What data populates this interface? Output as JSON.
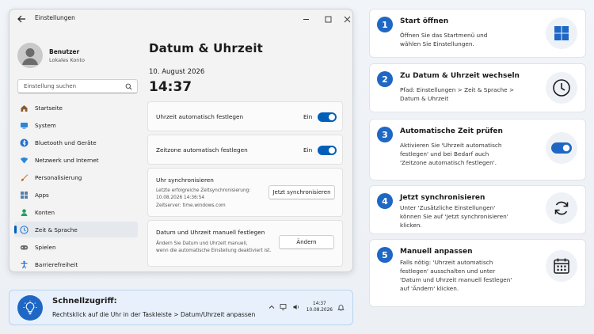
{
  "window": {
    "title": "Einstellungen",
    "profile": {
      "name": "Benutzer",
      "subtitle": "Lokales Konto"
    },
    "search_placeholder": "Einstellung suchen",
    "nav": [
      {
        "label": "Startseite",
        "icon": "home-icon"
      },
      {
        "label": "System",
        "icon": "system-icon"
      },
      {
        "label": "Bluetooth und Geräte",
        "icon": "bluetooth-icon"
      },
      {
        "label": "Netzwerk und Internet",
        "icon": "wifi-icon"
      },
      {
        "label": "Personalisierung",
        "icon": "brush-icon"
      },
      {
        "label": "Apps",
        "icon": "apps-icon"
      },
      {
        "label": "Konten",
        "icon": "accounts-icon"
      },
      {
        "label": "Zeit & Sprache",
        "icon": "time-language-icon",
        "active": true
      },
      {
        "label": "Spielen",
        "icon": "gaming-icon"
      },
      {
        "label": "Barrierefreiheit",
        "icon": "accessibility-icon"
      }
    ],
    "page_title": "Datum & Uhrzeit",
    "date": "10. August 2026",
    "time": "14:37",
    "auto_time": {
      "label": "Uhrzeit automatisch festlegen",
      "state": "Ein",
      "on": true
    },
    "auto_zone": {
      "label": "Zeitzone automatisch festlegen",
      "state": "Ein",
      "on": true
    },
    "sync": {
      "title": "Uhr synchronisieren",
      "last_sync_label": "Letzte erfolgreiche Zeitsynchronisierung:",
      "last_sync_value": "10.08.2026 14:36:54",
      "server": "Zeitserver: time.windows.com",
      "button": "Jetzt synchronisieren"
    },
    "manual": {
      "title": "Datum und Uhrzeit manuell festlegen",
      "desc_line1": "Ändern Sie Datum und Uhrzeit manuell,",
      "desc_line2": "wenn die automatische Einstellung deaktiviert ist.",
      "button": "Ändern"
    }
  },
  "tip": {
    "title": "Schnellzugriff:",
    "text": "Rechtsklick auf die Uhr in der Taskleiste > Datum/Uhrzeit anpassen",
    "clock_time": "14:37",
    "clock_date": "10.08.2026"
  },
  "steps": [
    {
      "number": "1",
      "title": "Start öffnen",
      "lines": [
        "Öffnen Sie das Startmenü und",
        "wählen Sie Einstellungen."
      ],
      "icon": "windows-logo-icon"
    },
    {
      "number": "2",
      "title": "Zu Datum & Uhrzeit wechseln",
      "lines": [
        "Pfad: Einstellungen > Zeit & Sprache >",
        "Datum & Uhrzeit"
      ],
      "icon": "clock-icon"
    },
    {
      "number": "3",
      "title": "Automatische Zeit prüfen",
      "lines": [
        "Aktivieren Sie 'Uhrzeit automatisch",
        "festlegen' und bei Bedarf auch",
        "'Zeitzone automatisch festlegen'."
      ],
      "icon": "toggle-icon"
    },
    {
      "number": "4",
      "title": "Jetzt synchronisieren",
      "lines": [
        "Unter 'Zusätzliche Einstellungen'",
        "können Sie auf 'Jetzt synchronisieren'",
        "klicken."
      ],
      "icon": "sync-icon"
    },
    {
      "number": "5",
      "title": "Manuell anpassen",
      "lines": [
        "Falls nötig: 'Uhrzeit automatisch",
        "festlegen' ausschalten und unter",
        "'Datum und Uhrzeit manuell festlegen'",
        "auf 'Ändern' klicken."
      ],
      "icon": "calendar-icon"
    }
  ],
  "colors": {
    "accent": "#005fb8",
    "step_blue": "#1e67c4"
  }
}
